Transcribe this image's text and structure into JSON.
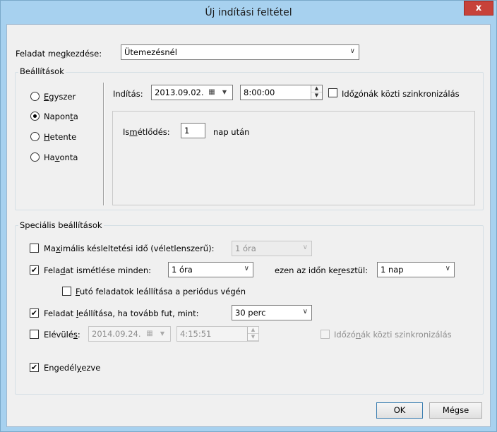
{
  "window": {
    "title": "Új indítási feltétel",
    "close_label": "x"
  },
  "start_task": {
    "label_pre": "Feladat me",
    "label_u": "g",
    "label_post": "kezdése:",
    "value": "Ütemezésnél"
  },
  "settings": {
    "legend": "Beállítások",
    "radios": [
      {
        "pre": "",
        "u": "E",
        "post": "gyszer",
        "checked": false
      },
      {
        "pre": "Napon",
        "u": "t",
        "post": "a",
        "checked": true
      },
      {
        "pre": "",
        "u": "H",
        "post": "etente",
        "checked": false
      },
      {
        "pre": "Ha",
        "u": "v",
        "post": "onta",
        "checked": false
      }
    ],
    "start_label": "Indítás:",
    "start_date": "2013.09.02.",
    "start_time": "8:00:00",
    "sync_pre": "Idő",
    "sync_u": "z",
    "sync_post": "ónák közti szinkronizálás",
    "repeat_pre": "Is",
    "repeat_u": "m",
    "repeat_post": "étlődés:",
    "repeat_value": "1",
    "repeat_suffix": "nap után"
  },
  "advanced": {
    "legend": "Speciális beállítások",
    "max_delay": {
      "pre": "Ma",
      "u": "x",
      "post": "imális késleltetési idő (véletlenszerű):",
      "value": "1 óra",
      "checked": false
    },
    "repeat_task": {
      "pre": "Fela",
      "u": "d",
      "post": "at ismétlése minden:",
      "value": "1 óra",
      "checked": true
    },
    "duration": {
      "pre": "ezen az időn ke",
      "u": "r",
      "post": "esztül:",
      "value": "1 nap"
    },
    "stop_running": {
      "pre": "",
      "u": "F",
      "post": "utó feladatok leállítása a periódus végén",
      "checked": false
    },
    "stop_task": {
      "pre": "Feladat ",
      "u": "l",
      "post": "eállítása, ha tovább fut, mint:",
      "value": "30 perc",
      "checked": true
    },
    "expire": {
      "pre": "Elévülé",
      "u": "s",
      "post": ":",
      "date": "2014.09.24.",
      "time": "4:15:51",
      "checked": false
    },
    "expire_sync": {
      "pre": "Időzó",
      "u": "n",
      "post": "ák közti szinkronizálás",
      "checked": false
    },
    "enabled": {
      "pre": "Engedél",
      "u": "y",
      "post": "ezve",
      "checked": true
    }
  },
  "buttons": {
    "ok": "OK",
    "cancel": "Mégse"
  },
  "icons": {
    "check": "✔",
    "dropdown": "chevron-down-icon",
    "calendar": "calendar-icon"
  }
}
